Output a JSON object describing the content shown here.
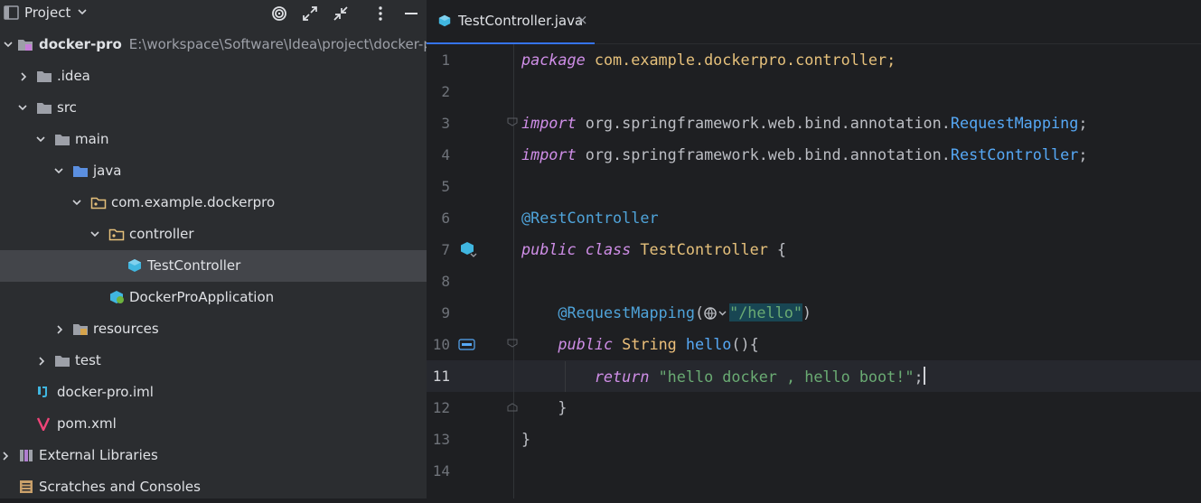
{
  "project_panel": {
    "title": "Project",
    "tree": [
      {
        "label": "docker-pro",
        "path": "E:\\workspace\\Software\\Idea\\project\\docker-pro"
      },
      {
        "label": ".idea"
      },
      {
        "label": "src"
      },
      {
        "label": "main"
      },
      {
        "label": "java"
      },
      {
        "label": "com.example.dockerpro"
      },
      {
        "label": "controller"
      },
      {
        "label": "TestController"
      },
      {
        "label": "DockerProApplication"
      },
      {
        "label": "resources"
      },
      {
        "label": "test"
      },
      {
        "label": "docker-pro.iml"
      },
      {
        "label": "pom.xml"
      },
      {
        "label": "External Libraries"
      },
      {
        "label": "Scratches and Consoles"
      }
    ]
  },
  "editor": {
    "tab": {
      "label": "TestController.java",
      "close": "×"
    },
    "line_numbers": [
      "1",
      "2",
      "3",
      "4",
      "5",
      "6",
      "7",
      "8",
      "9",
      "10",
      "11",
      "12",
      "13",
      "14"
    ],
    "current_line": 11,
    "code": {
      "l1": {
        "kw": "package",
        "rest": " com.example.dockerpro.controller;"
      },
      "l3": {
        "kw": "import",
        "pkg": " org.springframework.web.bind.annotation.",
        "cls": "RequestMapping",
        "end": ";"
      },
      "l4": {
        "kw": "import",
        "pkg": " org.springframework.web.bind.annotation.",
        "cls": "RestController",
        "end": ";"
      },
      "l6": {
        "ann": "@RestController"
      },
      "l7": {
        "kw1": "public",
        "kw2": "class",
        "cls": "TestController",
        "rest": " {"
      },
      "l9": {
        "ann": "@RequestMapping",
        "open": "(",
        "str": "\"/hello\"",
        "close": ")"
      },
      "l10": {
        "kw": "public",
        "typ": "String",
        "fn": "hello",
        "rest": "(){"
      },
      "l11": {
        "kw": "return",
        "str": "\"hello docker , hello boot!\"",
        "end": ";"
      },
      "l12": {
        "text": "}"
      },
      "l13": {
        "text": "}"
      }
    }
  },
  "colors": {
    "accent": "#3574f0",
    "panel": "#2b2d30",
    "editor": "#1e1f22",
    "selection": "#43454a"
  }
}
